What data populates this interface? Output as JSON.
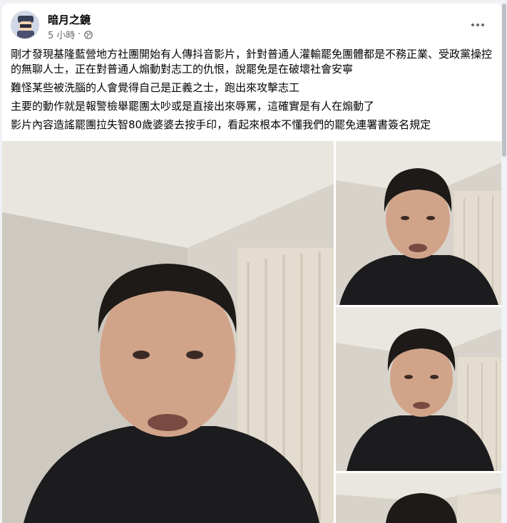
{
  "post": {
    "author": "暗月之鏡",
    "time": "5 小時",
    "separator": "·",
    "privacy_icon": "globe-icon",
    "more_icon": "more-dots-icon",
    "paragraphs": [
      "剛才發現基隆藍營地方社團開始有人傳抖音影片，針對普通人灌輸罷免團體都是不務正業、受政黨操控的無聊人士，正在對普通人煽動對志工的仇恨，說罷免是在破壞社會安寧",
      "難怪某些被洗腦的人會覺得自己是正義之士，跑出來攻擊志工",
      "主要的動作就是報警檢舉罷團太吵或是直接出來辱罵，這確實是有人在煽動了",
      "影片內容造謠罷團拉失智80歲婆婆去按手印，看起來根本不懂我們的罷免連署書簽名規定"
    ]
  },
  "gallery": {
    "photos": [
      "video-frame-main",
      "video-frame-2",
      "video-frame-3",
      "video-frame-4"
    ]
  },
  "colors": {
    "text": "#050505",
    "meta": "#65676b",
    "background": "#f0f2f5"
  }
}
